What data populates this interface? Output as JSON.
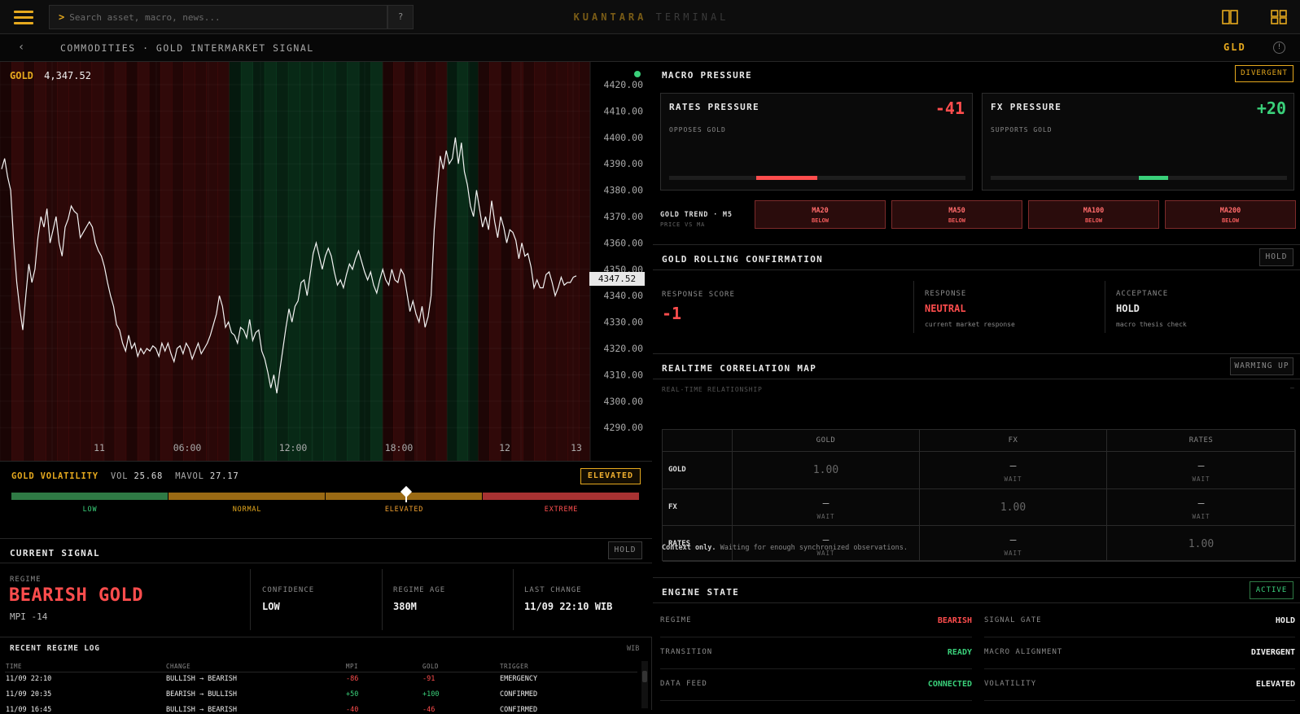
{
  "topbar": {
    "search_placeholder": "Search asset, macro, news...",
    "help_label": "?",
    "brand_primary": "KUANTARA",
    "brand_secondary": "TERMINAL",
    "prompt_glyph": ">"
  },
  "subbar": {
    "breadcrumb": "COMMODITIES · GOLD INTERMARKET SIGNAL",
    "ticker": "GLD",
    "back_glyph": "‹",
    "info_glyph": "!"
  },
  "chart": {
    "symbol": "GOLD",
    "price": "4,347.52",
    "current_price_tag": "4347.52",
    "status_color": "#3ad07a",
    "y_ticks": [
      "4420.00",
      "4410.00",
      "4400.00",
      "4390.00",
      "4380.00",
      "4370.00",
      "4360.00",
      "4350.00",
      "4340.00",
      "4330.00",
      "4320.00",
      "4310.00",
      "4300.00",
      "4290.00"
    ],
    "x_ticks": [
      "11",
      "06:00",
      "12:00",
      "18:00",
      "12",
      "13"
    ]
  },
  "chart_data": {
    "type": "line",
    "title": "",
    "xlabel": "",
    "ylabel": "",
    "ylim": [
      4286,
      4428
    ],
    "x_labels": [
      "11",
      "06:00",
      "12:00",
      "18:00",
      "12",
      "13"
    ],
    "series": [
      {
        "values": [
          4388,
          4392,
          4385,
          4380,
          4360,
          4345,
          4335,
          4327,
          4340,
          4352,
          4345,
          4350,
          4362,
          4370,
          4366,
          4373,
          4360,
          4365,
          4370,
          4360,
          4355,
          4366,
          4369,
          4374,
          4372,
          4371,
          4362,
          4364,
          4366,
          4368,
          4366,
          4360,
          4357,
          4355,
          4351,
          4345,
          4340,
          4336,
          4329,
          4327,
          4322,
          4319,
          4325,
          4320,
          4322,
          4317,
          4320,
          4318,
          4320,
          4319,
          4321,
          4320,
          4317,
          4322,
          4319,
          4322,
          4318,
          4315,
          4320,
          4321,
          4318,
          4322,
          4320,
          4316,
          4319,
          4322,
          4318,
          4320,
          4322,
          4325,
          4329,
          4333,
          4340,
          4336,
          4328,
          4330,
          4326,
          4325,
          4322,
          4328,
          4327,
          4324,
          4331,
          4323,
          4326,
          4327,
          4319,
          4316,
          4311,
          4305,
          4310,
          4303,
          4312,
          4320,
          4328,
          4335,
          4330,
          4336,
          4338,
          4345,
          4346,
          4340,
          4348,
          4356,
          4360,
          4355,
          4350,
          4355,
          4358,
          4355,
          4349,
          4344,
          4346,
          4343,
          4348,
          4352,
          4350,
          4354,
          4357,
          4353,
          4349,
          4346,
          4349,
          4344,
          4341,
          4346,
          4350,
          4346,
          4344,
          4350,
          4346,
          4345,
          4350,
          4348,
          4341,
          4334,
          4338,
          4333,
          4330,
          4336,
          4328,
          4332,
          4340,
          4365,
          4380,
          4393,
          4388,
          4395,
          4390,
          4392,
          4400,
          4390,
          4398,
          4387,
          4382,
          4374,
          4370,
          4380,
          4373,
          4366,
          4370,
          4365,
          4376,
          4368,
          4362,
          4370,
          4366,
          4360,
          4365,
          4364,
          4361,
          4354,
          4360,
          4355,
          4356,
          4351,
          4343,
          4346,
          4343,
          4343,
          4348,
          4349,
          4345,
          4340,
          4343,
          4347,
          4344,
          4345,
          4345,
          4347,
          4347.52
        ]
      }
    ],
    "regime_bands": [
      {
        "kind": "bear",
        "from": 0.0,
        "to": 0.388
      },
      {
        "kind": "bull",
        "from": 0.388,
        "to": 0.648
      },
      {
        "kind": "bear",
        "from": 0.648,
        "to": 0.757
      },
      {
        "kind": "bull",
        "from": 0.757,
        "to": 0.81
      },
      {
        "kind": "bear",
        "from": 0.81,
        "to": 1.0
      }
    ]
  },
  "volatility": {
    "title": "GOLD VOLATILITY",
    "vol_label": "VOL",
    "vol_value": "25.68",
    "mavol_label": "MAVOL",
    "mavol_value": "27.17",
    "badge": "ELEVATED",
    "level_pct": 62.8,
    "zones": [
      {
        "label": "LOW",
        "color": "#2f7a45"
      },
      {
        "label": "NORMAL",
        "color": "#9a6a14"
      },
      {
        "label": "ELEVATED",
        "color": "#9a6a14"
      },
      {
        "label": "EXTREME",
        "color": "#a83232"
      }
    ],
    "zone_label_colors": [
      "#3ad07a",
      "#e6a91e",
      "#f0a030",
      "#ff5050"
    ]
  },
  "current_signal": {
    "title": "CURRENT SIGNAL",
    "badge": "HOLD",
    "regime_label": "REGIME",
    "regime_value": "BEARISH GOLD",
    "mpi": "MPI -14",
    "confidence_label": "CONFIDENCE",
    "confidence_value": "LOW",
    "age_label": "REGIME AGE",
    "age_value": "380M",
    "last_change_label": "LAST CHANGE",
    "last_change_value": "11/09 22:10 WIB"
  },
  "regime_log": {
    "title": "RECENT REGIME LOG",
    "tz": "WIB",
    "columns": [
      "TIME",
      "CHANGE",
      "MPI",
      "GOLD",
      "TRIGGER"
    ],
    "rows": [
      {
        "time": "11/09 22:10",
        "change": "BULLISH → BEARISH",
        "mpi": "-86",
        "gold": "-91",
        "trigger": "EMERGENCY",
        "sign": "neg"
      },
      {
        "time": "11/09 20:35",
        "change": "BEARISH → BULLISH",
        "mpi": "+50",
        "gold": "+100",
        "trigger": "CONFIRMED",
        "sign": "pos"
      },
      {
        "time": "11/09 16:45",
        "change": "BULLISH → BEARISH",
        "mpi": "-40",
        "gold": "-46",
        "trigger": "CONFIRMED",
        "sign": "neg"
      }
    ]
  },
  "macro_pressure": {
    "title": "MACRO PRESSURE",
    "badge": "DIVERGENT",
    "rates": {
      "title": "RATES PRESSURE",
      "value": "-41",
      "sub": "OPPOSES GOLD",
      "color": "#ff4d4d",
      "level": -0.41
    },
    "fx": {
      "title": "FX PRESSURE",
      "value": "+20",
      "sub": "SUPPORTS GOLD",
      "color": "#3ad07a",
      "level": 0.2
    },
    "trend_title": "GOLD TREND · M5",
    "trend_sub": "PRICE VS MA",
    "ma": [
      {
        "label": "MA20",
        "state": "BELOW"
      },
      {
        "label": "MA50",
        "state": "BELOW"
      },
      {
        "label": "MA100",
        "state": "BELOW"
      },
      {
        "label": "MA200",
        "state": "BELOW"
      }
    ]
  },
  "rolling": {
    "title": "GOLD ROLLING CONFIRMATION",
    "badge": "HOLD",
    "score_label": "RESPONSE SCORE",
    "score_value": "-1",
    "response_label": "RESPONSE",
    "response_value": "NEUTRAL",
    "response_sub": "current market response",
    "acceptance_label": "ACCEPTANCE",
    "acceptance_value": "HOLD",
    "acceptance_sub": "macro thesis check"
  },
  "correlation": {
    "title": "REALTIME CORRELATION MAP",
    "badge": "WARMING UP",
    "sub": "REAL-TIME RELATIONSHIP",
    "sub_right": "—",
    "columns": [
      "GOLD",
      "FX",
      "RATES"
    ],
    "rows": [
      "GOLD",
      "FX",
      "RATES"
    ],
    "diag": "1.00",
    "dash": "—",
    "wait": "WAIT",
    "note_bold": "Context only.",
    "note": "Waiting for enough synchronized observations."
  },
  "engine": {
    "title": "ENGINE STATE",
    "badge": "ACTIVE",
    "left": [
      {
        "k": "REGIME",
        "v": "BEARISH",
        "color": "#ff4d4d"
      },
      {
        "k": "TRANSITION",
        "v": "READY",
        "color": "#3ad07a"
      },
      {
        "k": "DATA FEED",
        "v": "CONNECTED",
        "color": "#3ad07a"
      }
    ],
    "right": [
      {
        "k": "SIGNAL GATE",
        "v": "HOLD",
        "color": "#f0f0f0"
      },
      {
        "k": "MACRO ALIGNMENT",
        "v": "DIVERGENT",
        "color": "#f0f0f0"
      },
      {
        "k": "VOLATILITY",
        "v": "ELEVATED",
        "color": "#f0f0f0"
      }
    ]
  }
}
